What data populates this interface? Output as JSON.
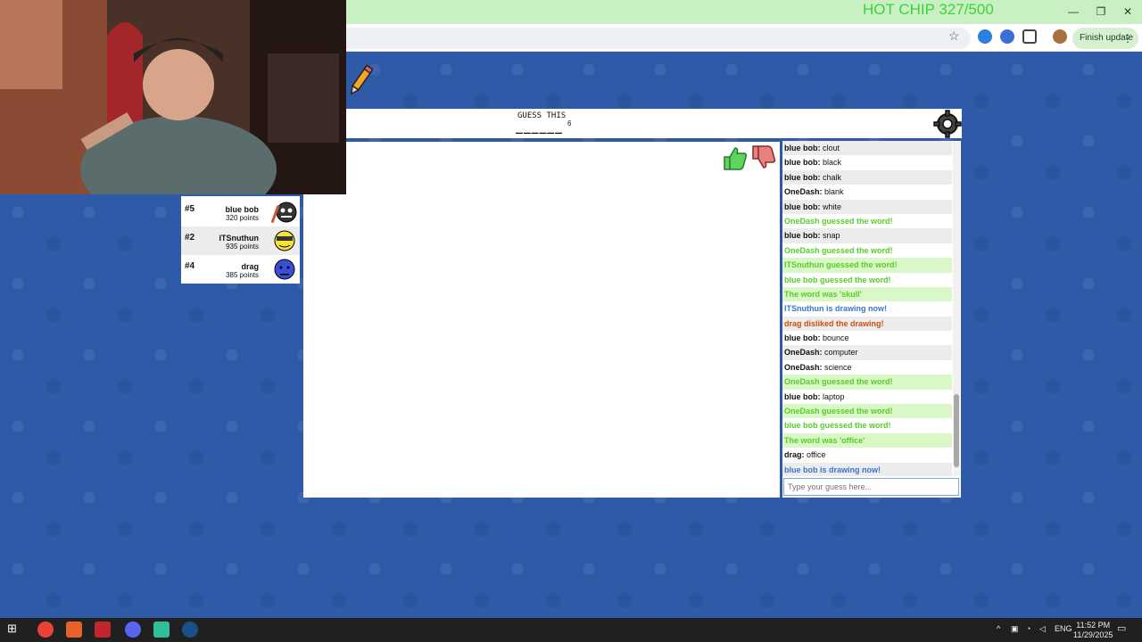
{
  "browser": {
    "hot_chip": "HOT CHIP 327/500",
    "finish_update": "Finish update",
    "min": "—",
    "restore": "❐",
    "close": "✕"
  },
  "header": {
    "guess_label": "GUESS THIS",
    "word_length": "6",
    "blanks": "______"
  },
  "players": [
    {
      "rank": "#5",
      "name": "blue bob",
      "score": "320 points"
    },
    {
      "rank": "#2",
      "name": "ITSnuthun",
      "score": "935 points"
    },
    {
      "rank": "#4",
      "name": "drag",
      "score": "385 points"
    }
  ],
  "chat": {
    "messages": [
      {
        "user": "blue bob:",
        "text": " clout"
      },
      {
        "user": "blue bob:",
        "text": " black"
      },
      {
        "user": "blue bob:",
        "text": " chalk"
      },
      {
        "user": "OneDash:",
        "text": " blank"
      },
      {
        "user": "blue bob:",
        "text": " white"
      },
      {
        "system": "OneDash guessed the word!"
      },
      {
        "user": "blue bob:",
        "text": " snap"
      },
      {
        "system": "OneDash guessed the word!"
      },
      {
        "system": "ITSnuthun guessed the word!"
      },
      {
        "system": "blue bob guessed the word!"
      },
      {
        "system": "The word was 'skull'"
      },
      {
        "info": "ITSnuthun is drawing now!"
      },
      {
        "dislike": "drag disliked the drawing!"
      },
      {
        "user": "blue bob:",
        "text": " bounce"
      },
      {
        "user": "OneDash:",
        "text": " computer"
      },
      {
        "user": "OneDash:",
        "text": " science"
      },
      {
        "system": "OneDash guessed the word!"
      },
      {
        "user": "blue bob:",
        "text": " laptop"
      },
      {
        "system": "OneDash guessed the word!"
      },
      {
        "system": "blue bob guessed the word!"
      },
      {
        "system": "The word was 'office'"
      },
      {
        "user": "drag:",
        "text": " office"
      },
      {
        "info": "blue bob is drawing now!"
      }
    ],
    "input_placeholder": "Type your guess here..."
  },
  "taskbar": {
    "lang": "ENG",
    "time": "11:52 PM",
    "date": "11/29/2025"
  }
}
